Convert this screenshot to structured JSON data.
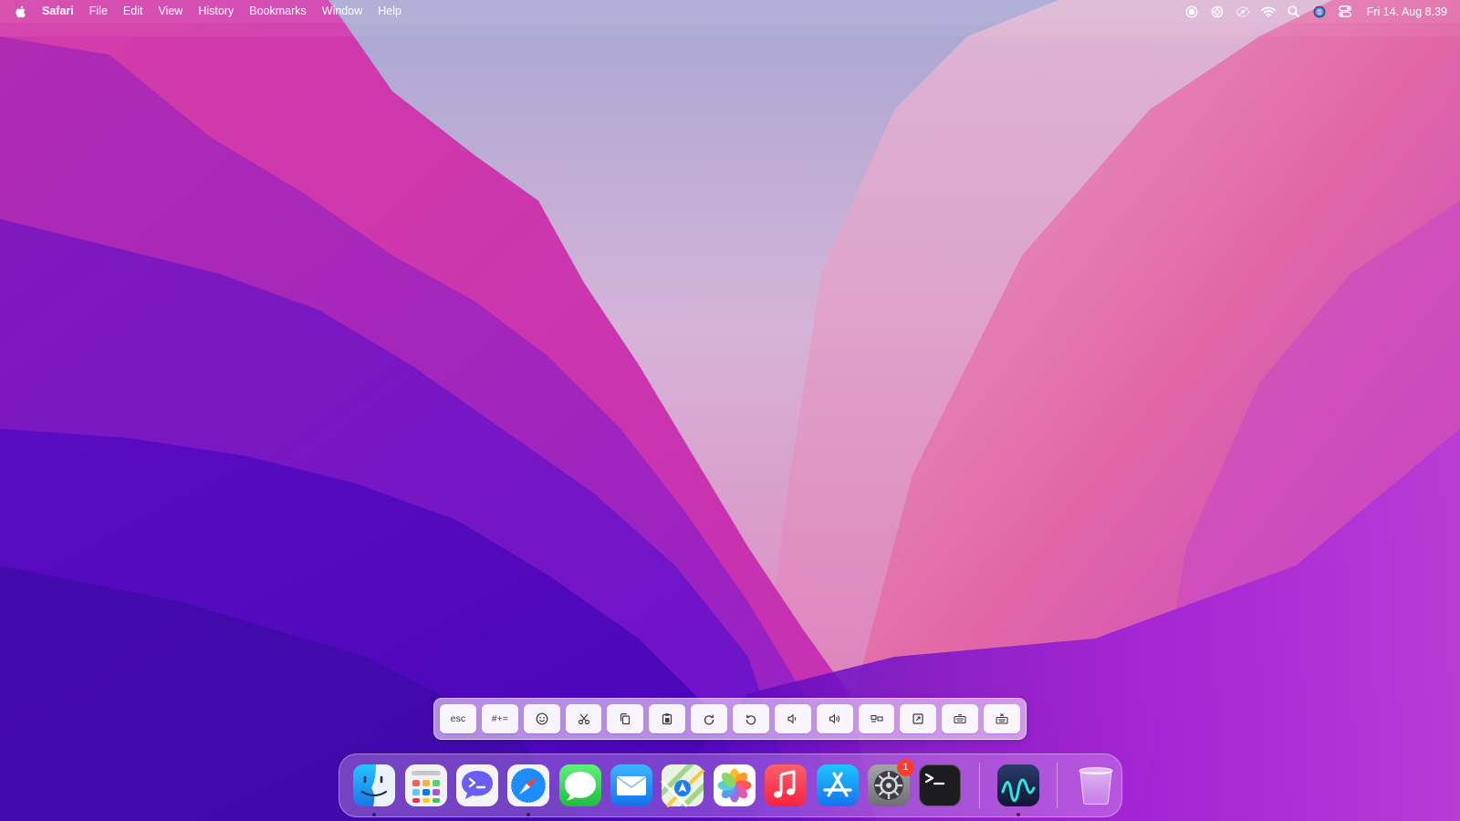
{
  "menubar": {
    "app_name": "Safari",
    "menus": [
      "File",
      "Edit",
      "View",
      "History",
      "Bookmarks",
      "Window",
      "Help"
    ],
    "status_icons": [
      "screen-record-icon",
      "sync-icon",
      "eye-slash-icon",
      "wifi-icon",
      "search-icon",
      "siri-icon",
      "control-center-icon"
    ],
    "clock": "Fri 14. Aug  8.39"
  },
  "shortcut_bar": {
    "keys": [
      {
        "label": "esc",
        "icon": "esc"
      },
      {
        "label": "#+=",
        "icon": "symbols"
      },
      {
        "label": "",
        "icon": "emoji-icon"
      },
      {
        "label": "",
        "icon": "cut-icon"
      },
      {
        "label": "",
        "icon": "copy-icon"
      },
      {
        "label": "",
        "icon": "paste-icon"
      },
      {
        "label": "",
        "icon": "redo-icon"
      },
      {
        "label": "",
        "icon": "undo-icon"
      },
      {
        "label": "",
        "icon": "volume-down-icon"
      },
      {
        "label": "",
        "icon": "volume-up-icon"
      },
      {
        "label": "",
        "icon": "display-icon"
      },
      {
        "label": "",
        "icon": "screenshot-icon"
      },
      {
        "label": "",
        "icon": "keyboard-icon"
      },
      {
        "label": "",
        "icon": "keyboard-hide-icon"
      }
    ]
  },
  "dock": {
    "apps": [
      {
        "name": "Finder",
        "icon": "finder-icon",
        "running": true
      },
      {
        "name": "Launchpad",
        "icon": "launchpad-icon",
        "running": false
      },
      {
        "name": "Remote Shell",
        "icon": "chat-terminal-icon",
        "running": false
      },
      {
        "name": "Safari",
        "icon": "safari-icon",
        "running": true
      },
      {
        "name": "Messages",
        "icon": "messages-icon",
        "running": false
      },
      {
        "name": "Mail",
        "icon": "mail-icon",
        "running": false
      },
      {
        "name": "Maps",
        "icon": "maps-icon",
        "running": false
      },
      {
        "name": "Photos",
        "icon": "photos-icon",
        "running": false
      },
      {
        "name": "Music",
        "icon": "music-icon",
        "running": false
      },
      {
        "name": "App Store",
        "icon": "app-store-icon",
        "running": false
      },
      {
        "name": "System Preferences",
        "icon": "system-preferences-icon",
        "running": false,
        "badge": "1"
      },
      {
        "name": "Terminal",
        "icon": "terminal-icon",
        "running": false
      }
    ],
    "recent": [
      {
        "name": "Remote App",
        "icon": "waveform-app-icon",
        "running": true
      }
    ],
    "trash": {
      "name": "Trash",
      "icon": "trash-icon"
    }
  },
  "colors": {
    "badge": "#ff3b30",
    "safari_blue": "#1e8cff",
    "messages_green": "#34c759",
    "music_red": "#fc3c44"
  }
}
